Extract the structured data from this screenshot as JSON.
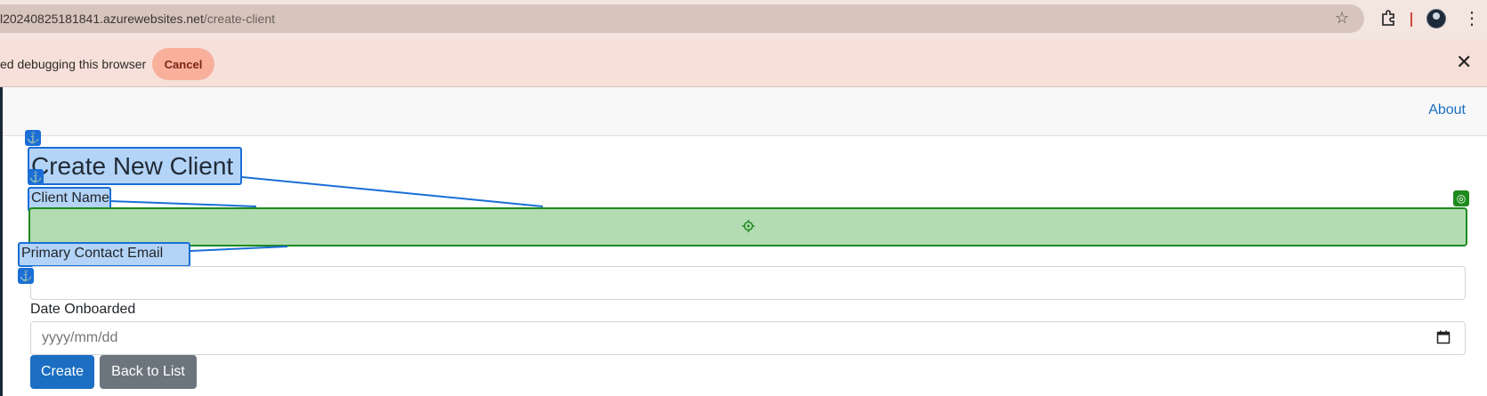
{
  "browser": {
    "url_host": "l20240825181841.azurewebsites.net",
    "url_path": "/create-client",
    "icons": [
      "star-icon",
      "extensions-icon",
      "profile-avatar",
      "more-menu-icon"
    ]
  },
  "infobar": {
    "message": "ed debugging this browser",
    "cancel_label": "Cancel"
  },
  "navbar": {
    "about_label": "About"
  },
  "form": {
    "title": "Create New Client",
    "client_name_label": "Client Name",
    "client_name_value": "",
    "email_label": "Primary Contact Email",
    "email_value": "",
    "date_label": "Date Onboarded",
    "date_placeholder": "yyyy/mm/dd",
    "create_label": "Create",
    "back_label": "Back to List"
  },
  "colors": {
    "link": "#1b6ec2",
    "primary_button": "#1b6ec2",
    "secondary_button": "#6c757d",
    "highlight_fill": "#b3d4f7",
    "highlight_border": "#1a6ed6",
    "target_fill": "#b3dcb3",
    "target_border": "#1e8a1e"
  }
}
